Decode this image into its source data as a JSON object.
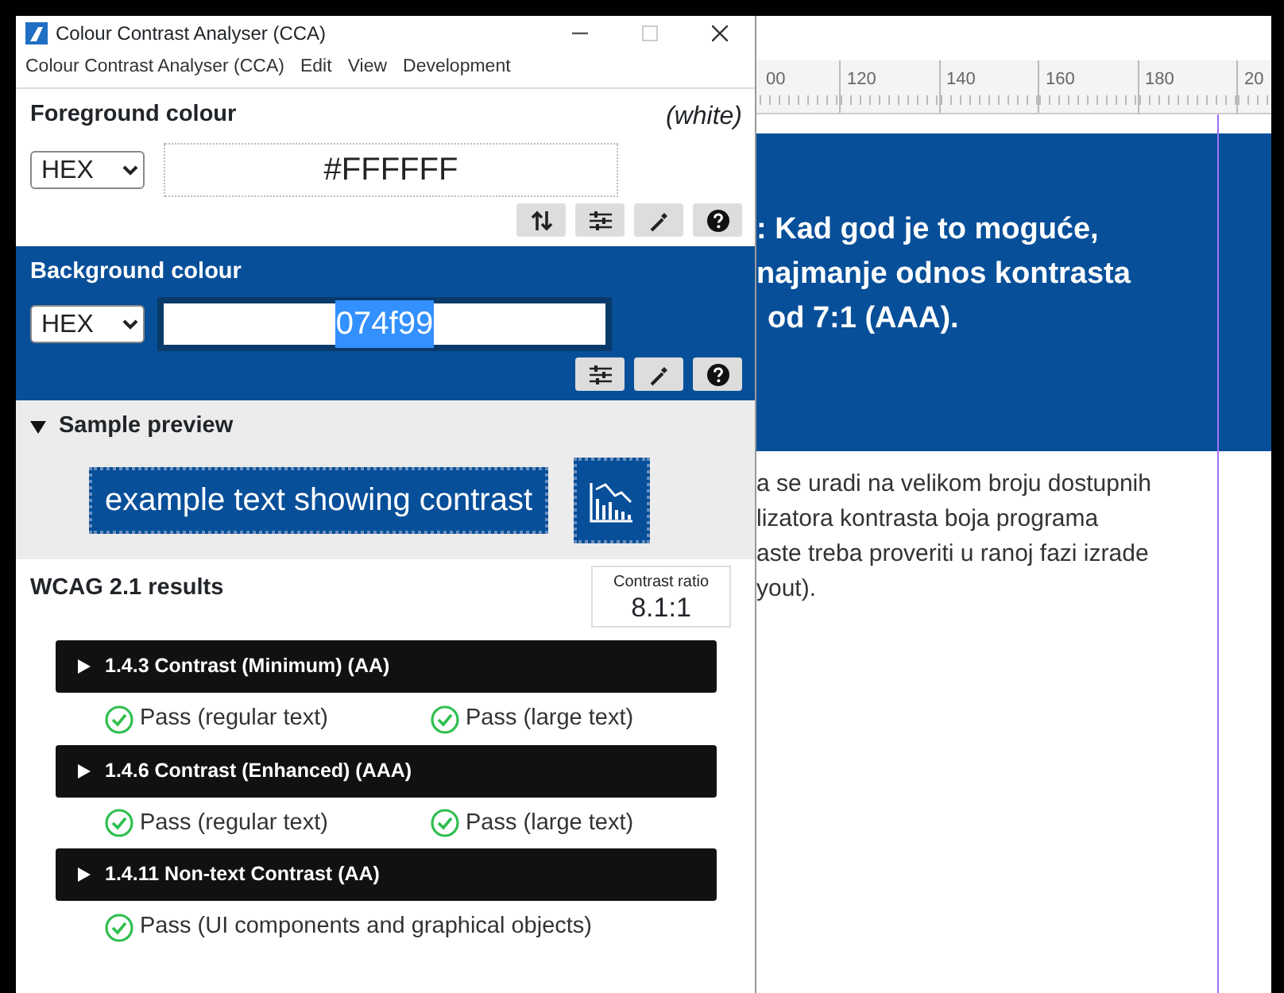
{
  "window": {
    "title": "Colour Contrast Analyser (CCA)"
  },
  "menu": [
    "Colour Contrast Analyser (CCA)",
    "Edit",
    "View",
    "Development"
  ],
  "foreground": {
    "label": "Foreground colour",
    "colour_name": "(white)",
    "format": "HEX",
    "value": "#FFFFFF"
  },
  "background": {
    "label": "Background colour",
    "format": "HEX",
    "value": "074f99",
    "value_selected": true
  },
  "sample_preview": {
    "label": "Sample preview",
    "expanded": true,
    "sample_text": "example text showing contrast"
  },
  "results": {
    "title": "WCAG 2.1 results",
    "ratio_label": "Contrast ratio",
    "ratio": "8.1:1",
    "criteria": [
      {
        "title": "1.4.3 Contrast (Minimum) (AA)",
        "expanded": false,
        "checks": [
          {
            "text": "Pass (regular text)",
            "pass": true
          },
          {
            "text": "Pass (large text)",
            "pass": true
          }
        ]
      },
      {
        "title": "1.4.6 Contrast (Enhanced) (AAA)",
        "expanded": false,
        "checks": [
          {
            "text": "Pass (regular text)",
            "pass": true
          },
          {
            "text": "Pass (large text)",
            "pass": true
          }
        ]
      },
      {
        "title": "1.4.11 Non-text Contrast (AA)",
        "expanded": false,
        "checks": [
          {
            "text": "Pass (UI components and graphical objects)",
            "pass": true
          }
        ]
      }
    ]
  },
  "document": {
    "ruler_labels": [
      "00",
      "120",
      "140",
      "160",
      "180",
      "20"
    ],
    "heading_lines": [
      ": Kad god je to moguće,",
      "najmanje odnos kontrasta",
      "od 7:1 (AAA)."
    ],
    "paragraph_lines": [
      "a se uradi na velikom broju dostupnih",
      "lizatora kontrasta boja programa",
      "aste treba proveriti u ranoj fazi izrade",
      "yout)."
    ]
  }
}
